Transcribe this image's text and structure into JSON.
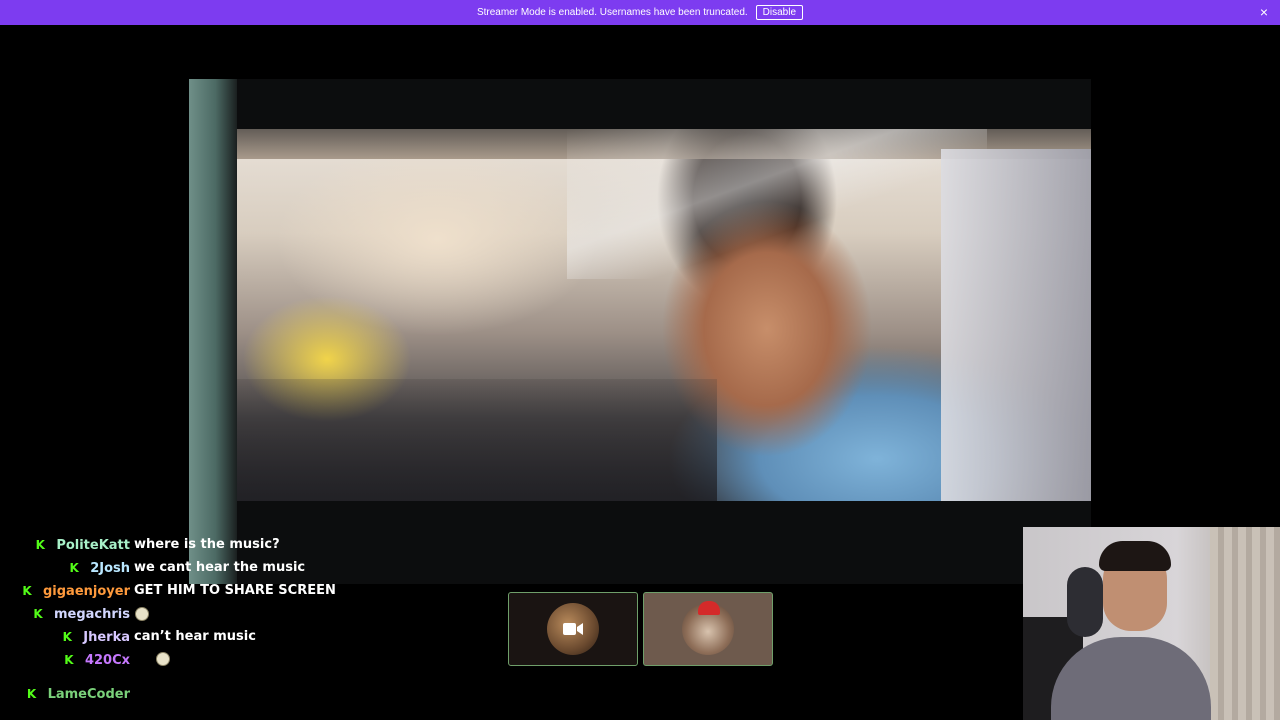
{
  "banner": {
    "message": "Streamer Mode is enabled. Usernames have been truncated.",
    "disable_label": "Disable",
    "close_icon": "×",
    "background": "#7d3cf0"
  },
  "chat": {
    "badge_color": "#53fc18",
    "messages": [
      {
        "user": "PoliteKatt",
        "user_color": "#a8f0c8",
        "text": "where is the music?"
      },
      {
        "user": "2Josh",
        "user_color": "#b9e7ff",
        "text": "we cant hear the music"
      },
      {
        "user": "gigaenjoyer",
        "user_color": "#ff9a3c",
        "text": "GET HIM TO SHARE SCREEN"
      },
      {
        "user": "megachris",
        "user_color": "#d2d7ff",
        "text": ""
      },
      {
        "user": "Jherka",
        "user_color": "#d7c8ff",
        "text": "can’t hear music"
      },
      {
        "user": "420Cx",
        "user_color": "#c678ff",
        "text": ""
      },
      {
        "user": "LameCoder",
        "user_color": "#7ad17a",
        "text": ""
      }
    ]
  },
  "participants": [
    {
      "name": "camera-off participant",
      "icon": "video-camera-icon"
    },
    {
      "name": "santa-hat participant",
      "icon": "santa-hat-icon"
    }
  ]
}
